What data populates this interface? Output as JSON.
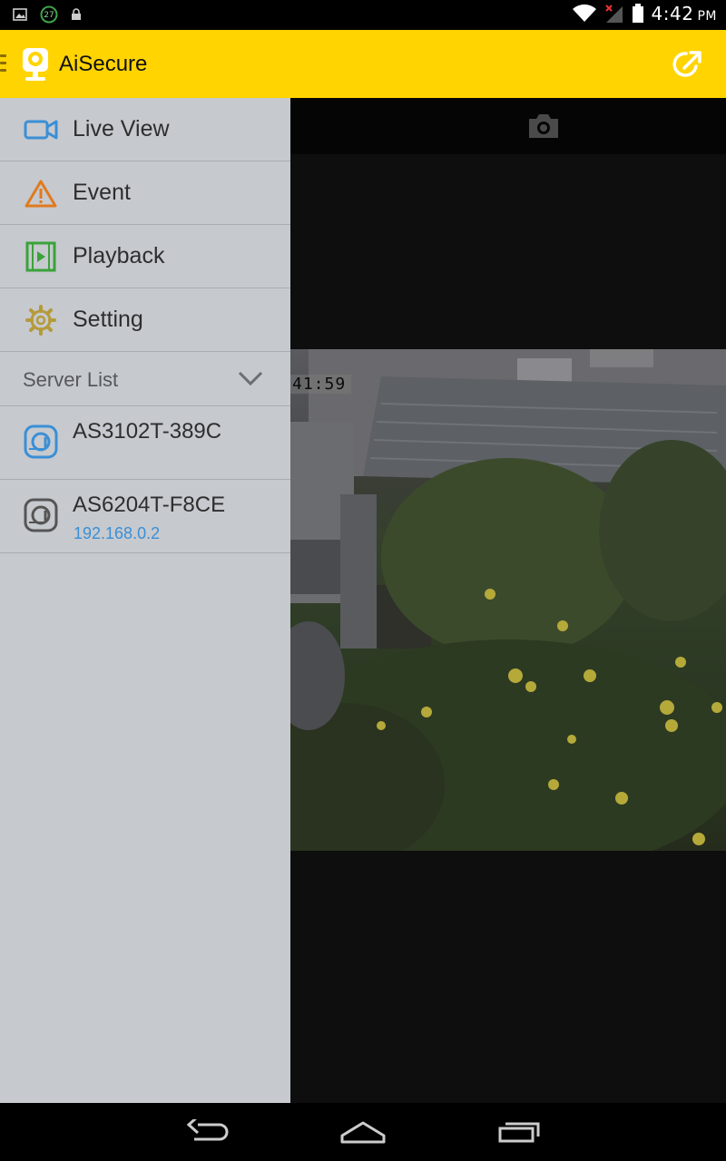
{
  "status_bar": {
    "notification_badge": "27",
    "time": "4:42",
    "ampm": "PM"
  },
  "app_bar": {
    "title": "AiSecure",
    "accent_color": "#ffd400"
  },
  "live": {
    "osd_time": "41:59"
  },
  "drawer": {
    "items": [
      {
        "label": "Live View",
        "icon": "video-camera-icon",
        "color": "#3a8fd6"
      },
      {
        "label": "Event",
        "icon": "warning-icon",
        "color": "#e07a1f"
      },
      {
        "label": "Playback",
        "icon": "film-play-icon",
        "color": "#3aa33a"
      },
      {
        "label": "Setting",
        "icon": "gear-icon",
        "color": "#b59a3a"
      }
    ],
    "server_list": {
      "label": "Server List",
      "servers": [
        {
          "name": "AS3102T-389C",
          "ip": "",
          "icon_color": "#3a8fd6"
        },
        {
          "name": "AS6204T-F8CE",
          "ip": "192.168.0.2",
          "icon_color": "#555555"
        }
      ]
    }
  }
}
